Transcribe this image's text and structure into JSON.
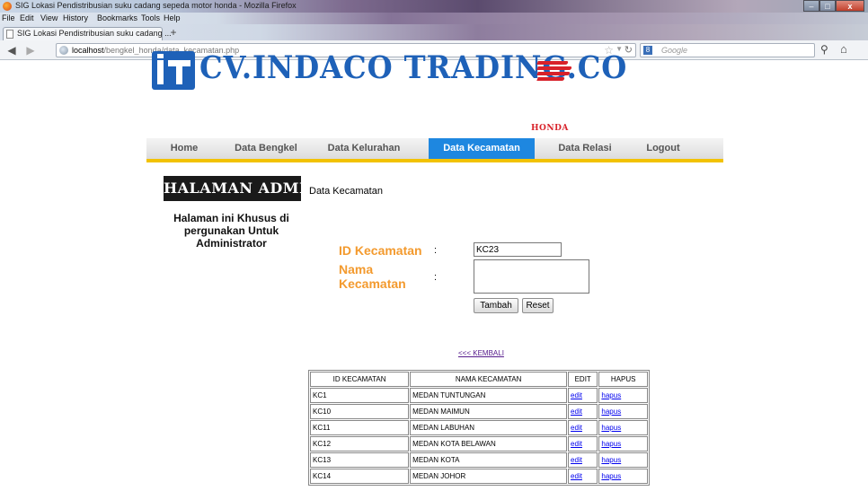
{
  "browser": {
    "window_title": "SIG Lokasi Pendistribusian suku cadang sepeda motor honda - Mozilla Firefox",
    "menu": [
      "File",
      "Edit",
      "View",
      "History",
      "Bookmarks",
      "Tools",
      "Help"
    ],
    "tab_label": "SIG Lokasi Pendistribusian suku cadang ...",
    "new_tab_icon": "+",
    "url_host": "localhost",
    "url_path": "/bengkel_honda/data_kecamatan.php",
    "search_placeholder": "Google"
  },
  "header": {
    "logo_text": "CV.INDACO TRADING.CO",
    "brand_text": "HONDA",
    "brand_color": "#d8222a",
    "logo_color": "#1e61b8"
  },
  "nav": {
    "items": [
      "Home",
      "Data Bengkel",
      "Data Kelurahan",
      "Data Kecamatan",
      "Data Relasi",
      "Logout"
    ],
    "active": "Data Kecamatan",
    "active_color": "#1e87e0",
    "accent_color": "#f2c200"
  },
  "sidebar": {
    "title": "HALAMAN ADMIN",
    "description": "Halaman ini Khusus di pergunakan Untuk Administrator"
  },
  "content": {
    "subtitle": "Data Kecamatan"
  },
  "form": {
    "label_id": "ID Kecamatan",
    "label_name": "Nama Kecamatan",
    "colon": ":",
    "id_value": "KC23",
    "name_value": "",
    "submit_label": "Tambah",
    "reset_label": "Reset",
    "label_color": "#f39a2e"
  },
  "back_link": "<<< KEMBALI",
  "table": {
    "headers": [
      "ID KECAMATAN",
      "NAMA KECAMATAN",
      "EDIT",
      "HAPUS"
    ],
    "rows": [
      {
        "id": "KC1",
        "name": "MEDAN TUNTUNGAN",
        "edit": "edit",
        "hapus": "hapus"
      },
      {
        "id": "KC10",
        "name": "MEDAN MAIMUN",
        "edit": "edit",
        "hapus": "hapus"
      },
      {
        "id": "KC11",
        "name": "MEDAN LABUHAN",
        "edit": "edit",
        "hapus": "hapus"
      },
      {
        "id": "KC12",
        "name": "MEDAN KOTA BELAWAN",
        "edit": "edit",
        "hapus": "hapus"
      },
      {
        "id": "KC13",
        "name": "MEDAN KOTA",
        "edit": "edit",
        "hapus": "hapus"
      },
      {
        "id": "KC14",
        "name": "MEDAN JOHOR",
        "edit": "edit",
        "hapus": "hapus"
      }
    ]
  }
}
